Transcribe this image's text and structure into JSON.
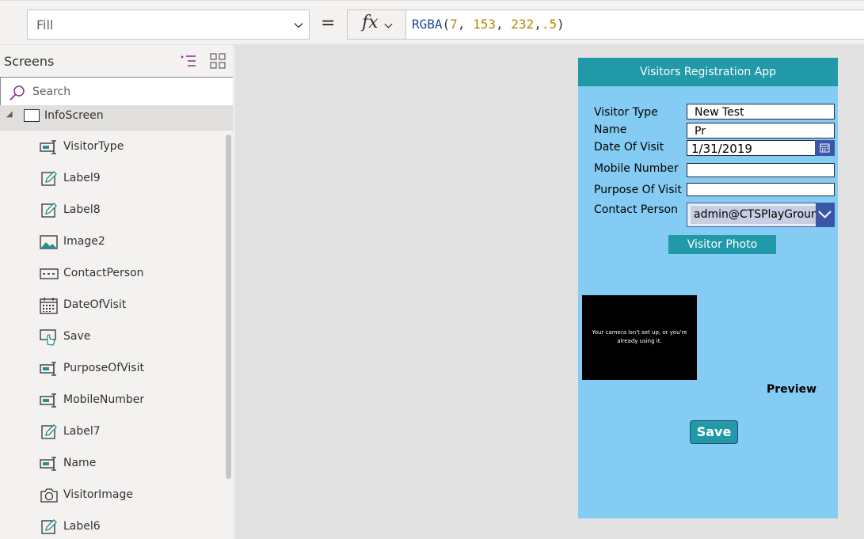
{
  "formula_bar": {
    "property": "Fill",
    "equals": "=",
    "fx": "fx",
    "formula_fn": "RGBA",
    "formula_open": "(",
    "r": "7",
    "g": "153",
    "b": "232",
    "a": ".5",
    "comma": ",",
    "formula_close": ")"
  },
  "tree": {
    "title": "Screens",
    "search_placeholder": "Search",
    "screen": "InfoScreen",
    "items": [
      {
        "label": "VisitorType",
        "icon": "text-input-icon"
      },
      {
        "label": "Label9",
        "icon": "label-icon"
      },
      {
        "label": "Label8",
        "icon": "label-icon"
      },
      {
        "label": "Image2",
        "icon": "image-icon"
      },
      {
        "label": "ContactPerson",
        "icon": "dropdown-icon"
      },
      {
        "label": "DateOfVisit",
        "icon": "date-picker-icon"
      },
      {
        "label": "Save",
        "icon": "button-icon"
      },
      {
        "label": "PurposeOfVisit",
        "icon": "text-input-icon"
      },
      {
        "label": "MobileNumber",
        "icon": "text-input-icon"
      },
      {
        "label": "Label7",
        "icon": "label-icon"
      },
      {
        "label": "Name",
        "icon": "text-input-icon"
      },
      {
        "label": "VisitorImage",
        "icon": "camera-icon"
      },
      {
        "label": "Label6",
        "icon": "label-icon"
      }
    ]
  },
  "app": {
    "header": "Visitors Registration App",
    "labels": {
      "visitor_type": "Visitor Type",
      "name": "Name",
      "date_of_visit": "Date Of Visit",
      "mobile_number": "Mobile Number",
      "purpose": "Purpose Of Visit",
      "contact_person": "Contact Person"
    },
    "values": {
      "visitor_type": "New Test",
      "name": "Pr",
      "date_of_visit": "1/31/2019",
      "mobile_number": "",
      "purpose": "",
      "contact_person": "admin@CTSPlayGround"
    },
    "visitor_photo_button": "Visitor Photo",
    "camera_message": "Your camera isn't set up, or you're already using it.",
    "preview_label": "Preview",
    "save_button": "Save"
  },
  "colors": {
    "app_background": "#84ccf4",
    "header_teal": "#2199a9",
    "dropdown_blue": "#3a56a6",
    "canvas": "#e1e1e1"
  }
}
